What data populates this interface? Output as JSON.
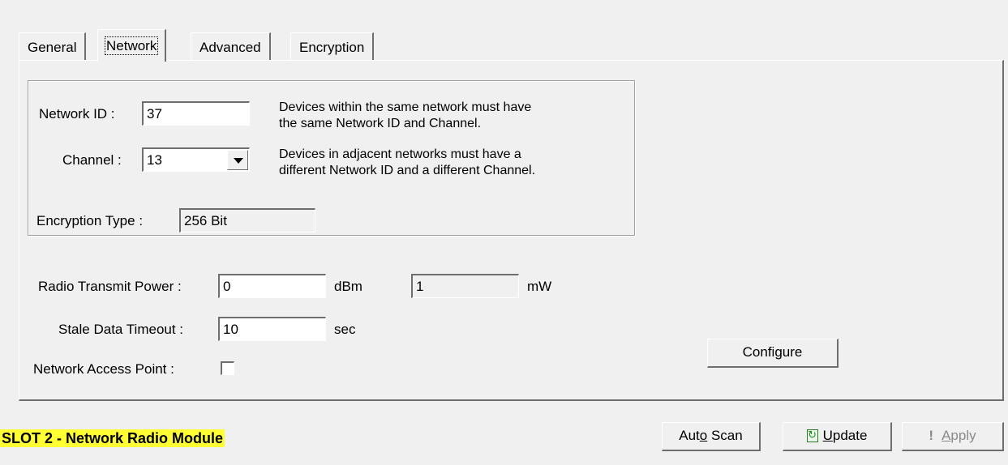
{
  "tabs": [
    {
      "label": "General"
    },
    {
      "label": "Network"
    },
    {
      "label": "Advanced"
    },
    {
      "label": "Encryption"
    }
  ],
  "network_group": {
    "network_id_label": "Network ID :",
    "network_id_value": "37",
    "channel_label": "Channel :",
    "channel_value": "13",
    "encryption_type_label": "Encryption Type :",
    "encryption_type_value": "256 Bit",
    "help_line1": "Devices within the same network must have",
    "help_line2": "the same Network ID and Channel.",
    "help_line3": "Devices in adjacent networks must have a",
    "help_line4": "different Network ID and a different Channel."
  },
  "radio": {
    "power_label": "Radio Transmit Power :",
    "power_value": "0",
    "power_unit": "dBm",
    "power_mw_value": "1",
    "power_mw_unit": "mW",
    "stale_label": "Stale Data Timeout :",
    "stale_value": "10",
    "stale_unit": "sec",
    "access_point_label": "Network Access Point :",
    "access_point_checked": false
  },
  "buttons": {
    "configure": "Configure",
    "auto_scan_pre": "Aut",
    "auto_scan_mnemonic": "o",
    "auto_scan_post": " Scan",
    "update_mnemonic": "U",
    "update_post": "pdate",
    "apply_mnemonic": "A",
    "apply_post": "pply"
  },
  "status": {
    "module_title": "SLOT 2 - Network Radio Module",
    "highlight_color": "#ffff33"
  },
  "icons": {
    "update": "update-refresh-icon",
    "apply": "exclamation-icon",
    "channel_dropdown": "chevron-down-icon"
  }
}
